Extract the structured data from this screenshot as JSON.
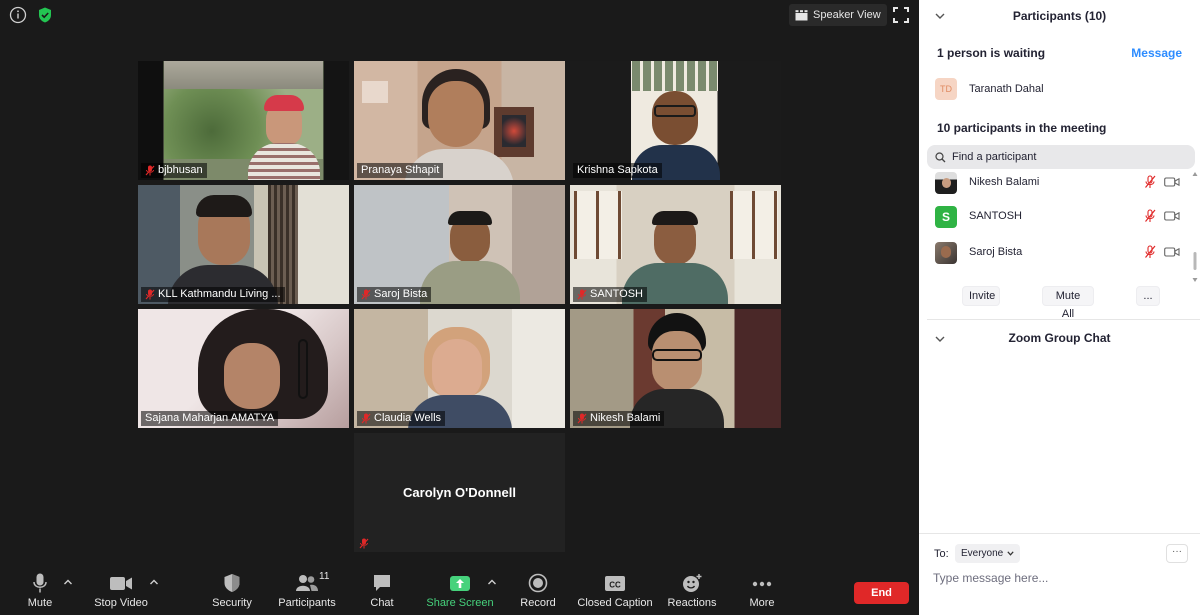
{
  "top_bar": {
    "speaker_view_label": "Speaker View"
  },
  "tiles": [
    {
      "name": "bjbhusan",
      "muted": true
    },
    {
      "name": "Pranaya Sthapit",
      "muted": false,
      "active": true
    },
    {
      "name": "Krishna Sapkota",
      "muted": false
    },
    {
      "name": "KLL Kathmandu Living ...",
      "muted": true
    },
    {
      "name": "Saroj Bista",
      "muted": true
    },
    {
      "name": "SANTOSH",
      "muted": true
    },
    {
      "name": "Sajana Maharjan AMATYA",
      "muted": false
    },
    {
      "name": "Claudia Wells",
      "muted": true
    },
    {
      "name": "Nikesh Balami",
      "muted": true
    },
    {
      "name": "Carolyn O'Donnell",
      "muted": true,
      "video_off": true
    }
  ],
  "toolbar": {
    "mute": "Mute",
    "stop_video": "Stop Video",
    "security": "Security",
    "participants": "Participants",
    "participants_count": "11",
    "chat": "Chat",
    "share_screen": "Share Screen",
    "record": "Record",
    "closed_caption": "Closed Caption",
    "reactions": "Reactions",
    "more": "More",
    "end": "End"
  },
  "panel": {
    "participants_title": "Participants (10)",
    "waiting_text": "1 person is waiting",
    "message_button": "Message",
    "waiting_person": {
      "initials": "TD",
      "name": "Taranath Dahal"
    },
    "in_meeting_text": "10 participants in the meeting",
    "search_placeholder": "Find a participant",
    "participants": [
      {
        "name": "Nikesh Balami",
        "avatar": "photo"
      },
      {
        "name": "SANTOSH",
        "avatar": "S",
        "avatar_color": "#2fb344"
      },
      {
        "name": "Saroj Bista",
        "avatar": "photo"
      }
    ],
    "invite_button": "Invite",
    "mute_all_button": "Mute All",
    "more_button": "...",
    "chat_title": "Zoom Group Chat",
    "to_label": "To:",
    "recipient": "Everyone",
    "chat_more": "···",
    "chat_placeholder": "Type message here..."
  },
  "colors": {
    "active_speaker_border": "#c7e34b",
    "end_button": "#e02828",
    "share_screen": "#46d27c",
    "link_blue": "#2d8cff",
    "muted_red": "#e02828"
  }
}
